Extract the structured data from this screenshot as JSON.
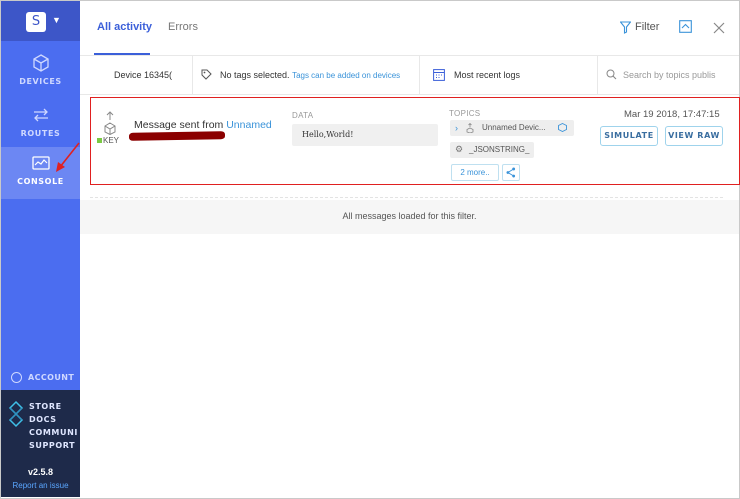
{
  "sidebar": {
    "avatar_letter": "S",
    "nav": [
      {
        "label": "DEVICES",
        "icon": "cube-icon"
      },
      {
        "label": "ROUTES",
        "icon": "routes-icon"
      },
      {
        "label": "CONSOLE",
        "icon": "console-icon",
        "active": true
      }
    ],
    "account_label": "ACCOUNT",
    "bottom_links": [
      "STORE",
      "DOCS",
      "COMMUNITY",
      "SUPPORT"
    ],
    "version": "v2.5.8",
    "report_link": "Report an issue"
  },
  "tabs": [
    {
      "label": "All activity",
      "active": true
    },
    {
      "label": "Errors"
    }
  ],
  "header": {
    "filter_label": "Filter",
    "icons": [
      "filter-icon",
      "export-icon",
      "close-icon"
    ]
  },
  "filterbar": {
    "device": "Device 16345(",
    "tags_text": "No tags selected.",
    "tags_hint": "Tags can be added on devices",
    "logs_label": "Most recent logs",
    "search_placeholder": "Search by topics publis"
  },
  "log": {
    "message_prefix": "Message sent from",
    "device_name": "Unnamed",
    "key_label": "KEY",
    "data_label": "DATA",
    "data_value": "Hello,World!",
    "topics_label": "TOPICS",
    "topics": [
      "Unnamed Devic...",
      "_JSONSTRING_"
    ],
    "more_label": "2 more..",
    "timestamp": "Mar 19 2018, 17:47:15",
    "simulate_label": "SIMULATE",
    "view_raw_label": "VIEW RAW"
  },
  "footer_message": "All messages loaded for this filter.",
  "colors": {
    "sidebar": "#4b6df0",
    "sidebar_bottom": "#1e2a4a",
    "accent": "#3b5fd9",
    "link": "#3a93d9",
    "highlight_border": "#e02020"
  }
}
